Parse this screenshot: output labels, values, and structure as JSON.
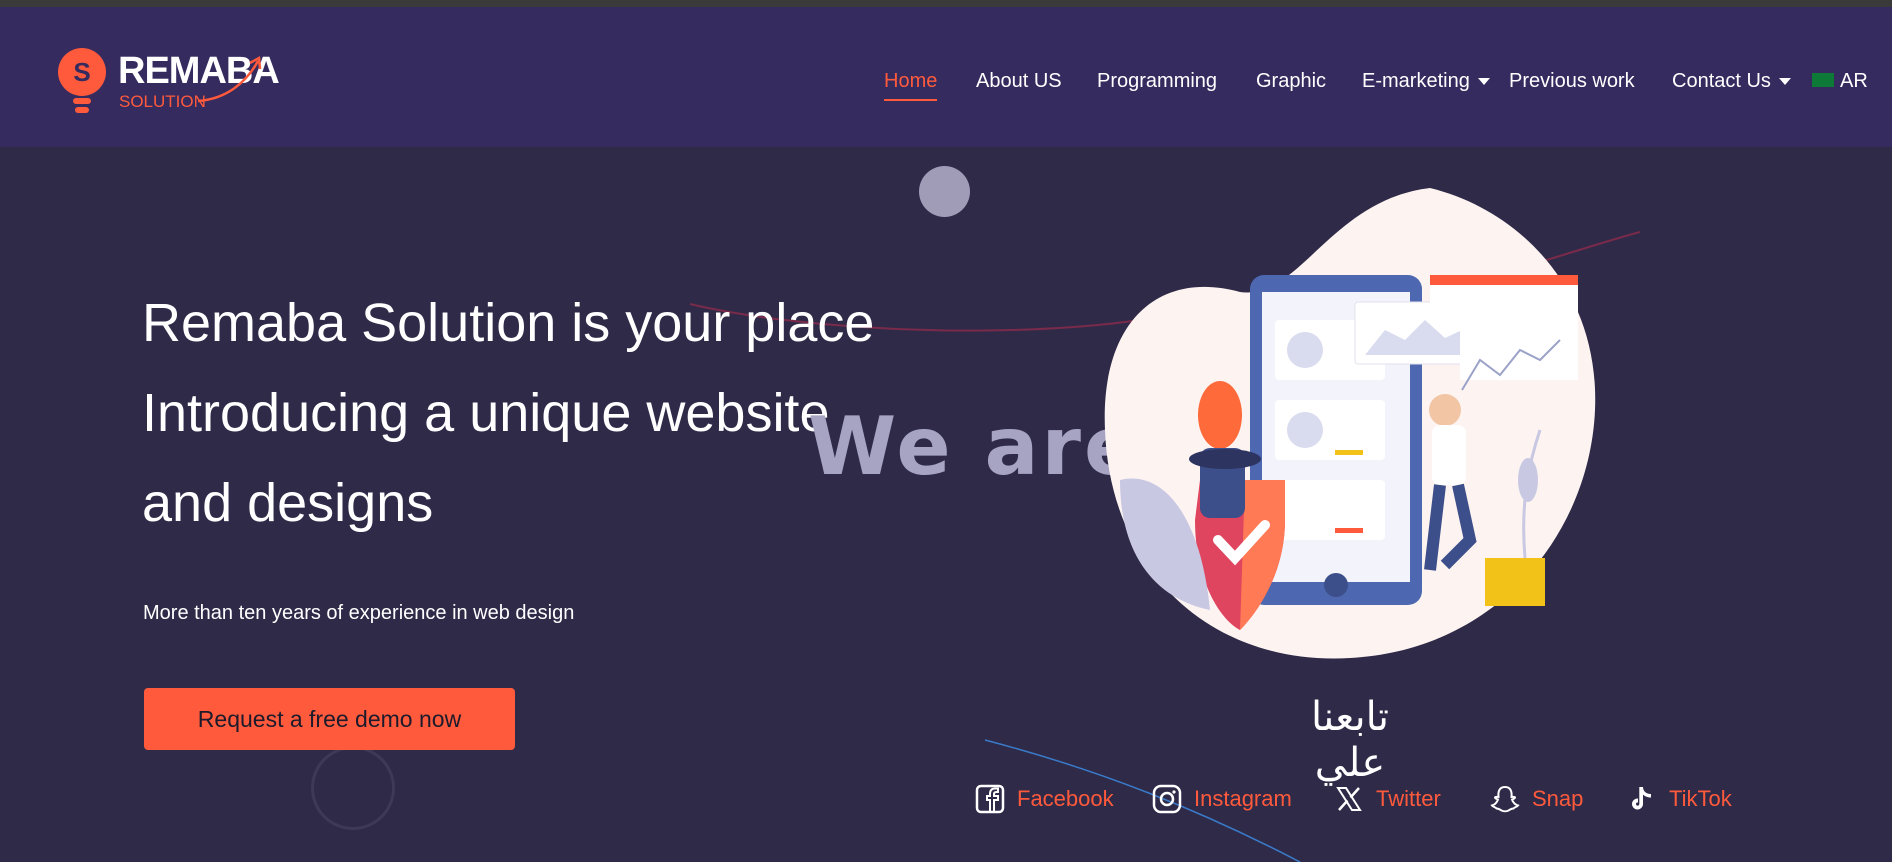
{
  "brand": {
    "title": "REMABA",
    "subtitle": "SOLUTION",
    "accent": "#ff5a3c",
    "header_bg": "#352b5f",
    "page_bg": "#2e2a48"
  },
  "nav": {
    "items": [
      {
        "label": "Home",
        "active": true
      },
      {
        "label": "About US"
      },
      {
        "label": "Programming"
      },
      {
        "label": "Graphic"
      },
      {
        "label": "E-marketing",
        "dropdown": true
      },
      {
        "label": "Previous work"
      },
      {
        "label": "Contact Us",
        "dropdown": true
      },
      {
        "label": "AR",
        "icon": "saudi-flag-icon"
      }
    ]
  },
  "hero": {
    "lines": [
      "Remaba Solution is your place",
      "Introducing a unique website",
      "and designs"
    ],
    "overlay": "We are",
    "subtitle": "More than ten years of experience in web design",
    "cta": "Request a free demo now"
  },
  "follow": {
    "heading": "تابعنا علي",
    "links": [
      {
        "label": "Facebook",
        "icon": "facebook-icon"
      },
      {
        "label": "Instagram",
        "icon": "instagram-icon"
      },
      {
        "label": "Twitter",
        "icon": "x-twitter-icon"
      },
      {
        "label": "Snap",
        "icon": "snapchat-icon"
      },
      {
        "label": "TikTok",
        "icon": "tiktok-icon"
      }
    ]
  }
}
